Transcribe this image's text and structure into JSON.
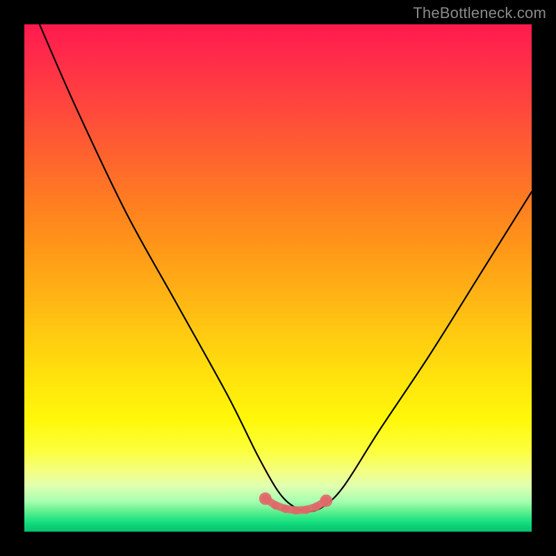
{
  "watermark": "TheBottleneck.com",
  "colors": {
    "frame": "#000000",
    "curve": "#000000",
    "marker": "#e06868",
    "marker_opacity": 0.9
  },
  "chart_data": {
    "type": "line",
    "title": "",
    "xlabel": "",
    "ylabel": "",
    "xlim": [
      0,
      100
    ],
    "ylim": [
      0,
      100
    ],
    "grid": false,
    "legend": false,
    "series": [
      {
        "name": "bottleneck-curve",
        "x": [
          3,
          10,
          20,
          30,
          40,
          46,
          50,
          53,
          56,
          59,
          63,
          70,
          80,
          90,
          100
        ],
        "values": [
          100,
          84,
          63,
          45,
          27,
          15,
          8,
          5,
          4,
          5,
          9,
          20,
          35,
          51,
          67
        ]
      }
    ],
    "markers": {
      "name": "optimal-range",
      "x": [
        47.5,
        49.5,
        51.5,
        53.5,
        55.5,
        57.5,
        59.5
      ],
      "values": [
        6.5,
        5.2,
        4.5,
        4.2,
        4.3,
        4.9,
        6.1
      ]
    }
  }
}
